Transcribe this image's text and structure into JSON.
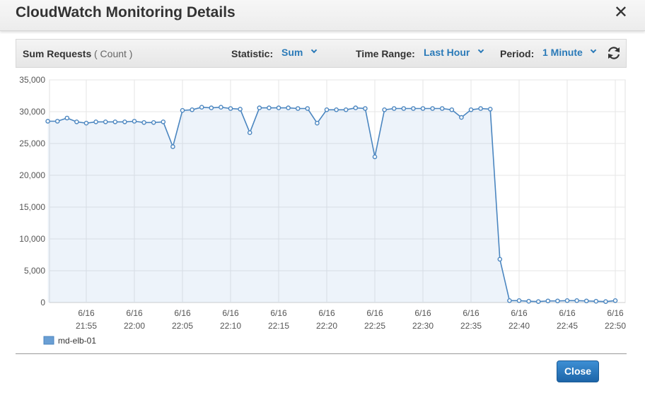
{
  "dialog": {
    "title": "CloudWatch Monitoring Details",
    "close_glyph": "✕",
    "close_button_label": "Close"
  },
  "toolbar": {
    "metric_name": "Sum Requests",
    "metric_unit": "( Count )",
    "statistic_label": "Statistic:",
    "statistic_value": "Sum",
    "time_range_label": "Time Range:",
    "time_range_value": "Last Hour",
    "period_label": "Period:",
    "period_value": "1 Minute",
    "refresh_icon": "refresh-icon"
  },
  "colors": {
    "accent": "#2a7ab8",
    "series": "#4b86c0",
    "series_fill": "#6a9fd4",
    "grid": "#e6e6e6",
    "button": "#2672b8"
  },
  "chart_data": {
    "type": "line",
    "ylim": [
      0,
      35000
    ],
    "y_ticks": [
      "35,000",
      "30,000",
      "25,000",
      "20,000",
      "15,000",
      "10,000",
      "5,000",
      "0"
    ],
    "y_tick_values": [
      35000,
      30000,
      25000,
      20000,
      15000,
      10000,
      5000,
      0
    ],
    "x_ticks": [
      {
        "date": "6/16",
        "time": "21:55"
      },
      {
        "date": "6/16",
        "time": "22:00"
      },
      {
        "date": "6/16",
        "time": "22:05"
      },
      {
        "date": "6/16",
        "time": "22:10"
      },
      {
        "date": "6/16",
        "time": "22:15"
      },
      {
        "date": "6/16",
        "time": "22:20"
      },
      {
        "date": "6/16",
        "time": "22:25"
      },
      {
        "date": "6/16",
        "time": "22:30"
      },
      {
        "date": "6/16",
        "time": "22:35"
      },
      {
        "date": "6/16",
        "time": "22:40"
      },
      {
        "date": "6/16",
        "time": "22:45"
      },
      {
        "date": "6/16",
        "time": "22:50"
      }
    ],
    "grid": true,
    "legend_position": "bottom-left",
    "series": [
      {
        "name": "md-elb-01",
        "x": [
          "21:51",
          "21:52",
          "21:53",
          "21:54",
          "21:55",
          "21:56",
          "21:57",
          "21:58",
          "21:59",
          "22:00",
          "22:01",
          "22:02",
          "22:03",
          "22:04",
          "22:05",
          "22:06",
          "22:07",
          "22:08",
          "22:09",
          "22:10",
          "22:11",
          "22:12",
          "22:13",
          "22:14",
          "22:15",
          "22:16",
          "22:17",
          "22:18",
          "22:19",
          "22:20",
          "22:21",
          "22:22",
          "22:23",
          "22:24",
          "22:25",
          "22:26",
          "22:27",
          "22:28",
          "22:29",
          "22:30",
          "22:31",
          "22:32",
          "22:33",
          "22:34",
          "22:35",
          "22:36",
          "22:37",
          "22:38",
          "22:39",
          "22:40",
          "22:41",
          "22:42",
          "22:43",
          "22:44",
          "22:45",
          "22:46",
          "22:47",
          "22:48",
          "22:49",
          "22:50"
        ],
        "values": [
          28500,
          28500,
          29000,
          28400,
          28200,
          28400,
          28400,
          28400,
          28400,
          28500,
          28300,
          28300,
          28400,
          24500,
          30200,
          30300,
          30700,
          30600,
          30700,
          30500,
          30400,
          26700,
          30600,
          30600,
          30600,
          30600,
          30500,
          30500,
          28200,
          30300,
          30300,
          30300,
          30600,
          30500,
          22900,
          30300,
          30500,
          30500,
          30500,
          30500,
          30500,
          30500,
          30300,
          29100,
          30300,
          30500,
          30400,
          6800,
          300,
          300,
          200,
          150,
          250,
          250,
          300,
          300,
          250,
          200,
          150,
          300
        ]
      }
    ]
  }
}
